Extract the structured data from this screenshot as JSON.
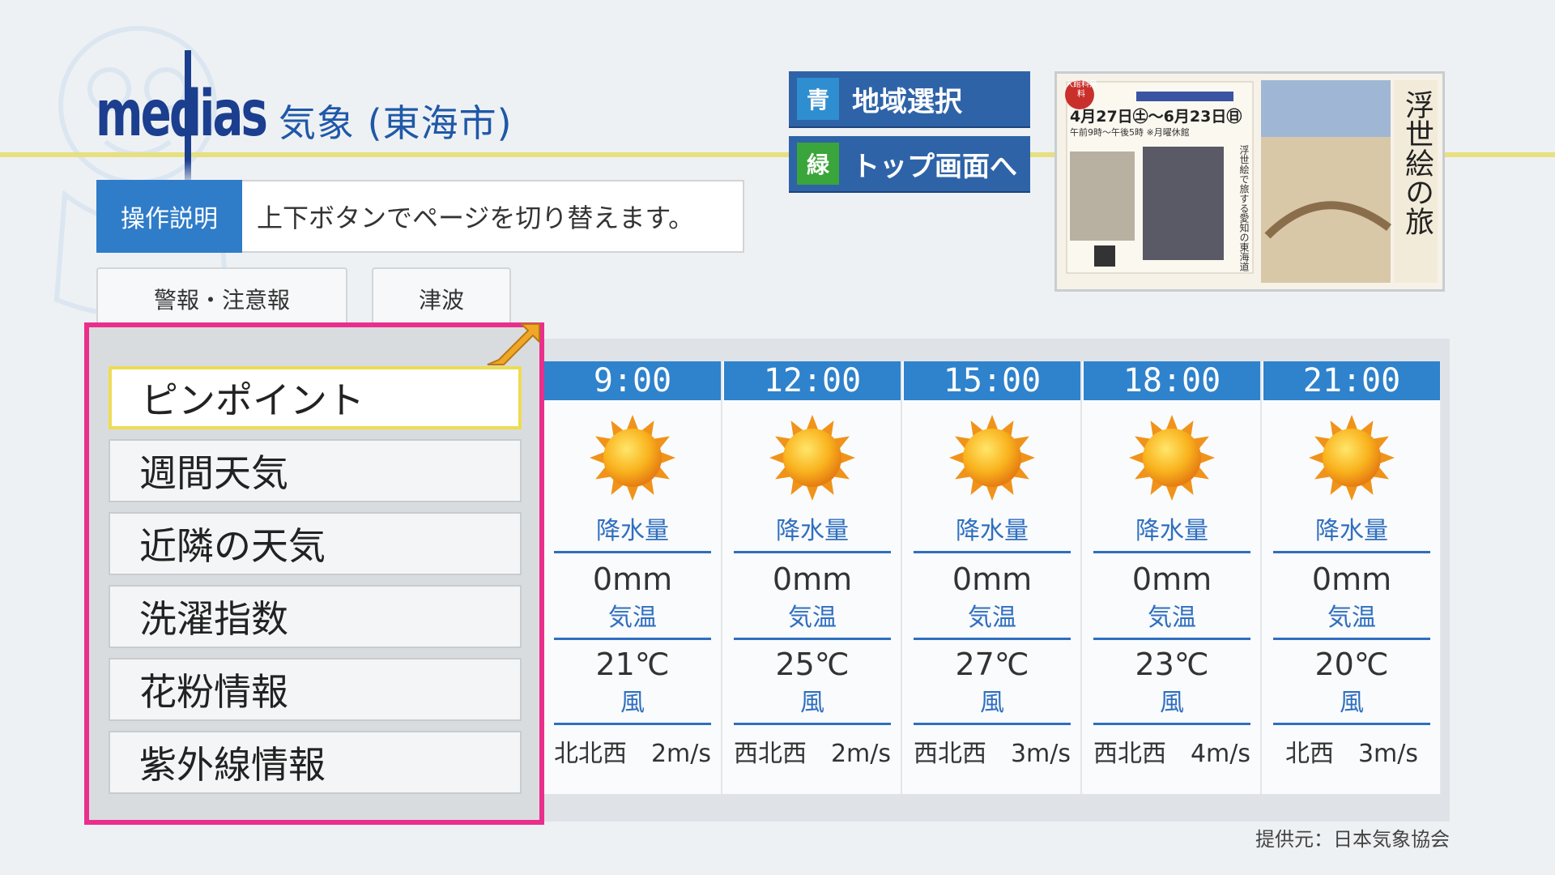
{
  "header": {
    "logo_text": "medias",
    "title": "気象 (東海市)"
  },
  "howto": {
    "label": "操作説明",
    "text": "上下ボタンでページを切り替えます。"
  },
  "tabs": [
    "警報・注意報",
    "津波"
  ],
  "buttons": [
    {
      "chip": "青",
      "label": "地域選択",
      "color": "#2f8ed0"
    },
    {
      "chip": "緑",
      "label": "トップ画面へ",
      "color": "#3aa53a"
    }
  ],
  "ad": {
    "badge": "入館料無料",
    "dates": "4月27日㊏～6月23日㊐",
    "hours": "午前9時～午後5時 ※月曜休館",
    "title": "浮世絵の旅",
    "subtitle": "浮世絵で旅する愛知の東海道"
  },
  "menu": {
    "selected_index": 0,
    "items": [
      "ピンポイント",
      "週間天気",
      "近隣の天気",
      "洗濯指数",
      "花粉情報",
      "紫外線情報"
    ]
  },
  "forecast": {
    "labels": {
      "precip": "降水量",
      "temp": "気温",
      "wind": "風"
    },
    "columns": [
      {
        "time": "9:00",
        "icon": "sunny-icon",
        "precip": "0mm",
        "temp": "21℃",
        "wind": "北北西　2m/s"
      },
      {
        "time": "12:00",
        "icon": "sunny-icon",
        "precip": "0mm",
        "temp": "25℃",
        "wind": "西北西　2m/s"
      },
      {
        "time": "15:00",
        "icon": "sunny-icon",
        "precip": "0mm",
        "temp": "27℃",
        "wind": "西北西　3m/s"
      },
      {
        "time": "18:00",
        "icon": "sunny-icon",
        "precip": "0mm",
        "temp": "23℃",
        "wind": "西北西　4m/s"
      },
      {
        "time": "21:00",
        "icon": "sunny-icon",
        "precip": "0mm",
        "temp": "20℃",
        "wind": "北西　3m/s"
      }
    ]
  },
  "credit": "提供元：日本気象協会",
  "colors": {
    "accent": "#2f82cc",
    "highlight": "#ea2e8c",
    "selected_border": "#eedc52"
  }
}
